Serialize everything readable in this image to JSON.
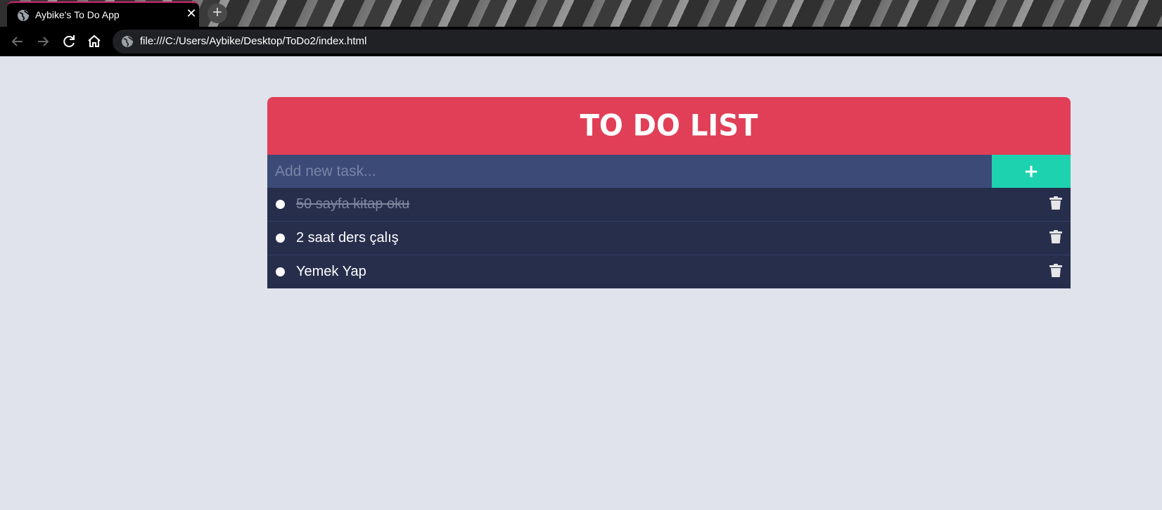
{
  "browser": {
    "tab_title": "Aybike's To Do App",
    "tab_close": "✕",
    "new_tab": "+",
    "url": "file:///C:/Users/Aybike/Desktop/ToDo2/index.html"
  },
  "app": {
    "title": "TO DO LIST",
    "input_placeholder": "Add new task...",
    "input_value": "",
    "add_label": "+",
    "tasks": [
      {
        "text": "50 sayfa kitap oku",
        "completed": true
      },
      {
        "text": "2 saat ders çalış",
        "completed": false
      },
      {
        "text": "Yemek Yap",
        "completed": false
      }
    ]
  },
  "colors": {
    "header": "#e03f57",
    "input_bg": "#3c4a78",
    "add_button": "#1dd2af",
    "list_bg": "#262e4c",
    "page_bg": "#e0e3ec"
  }
}
